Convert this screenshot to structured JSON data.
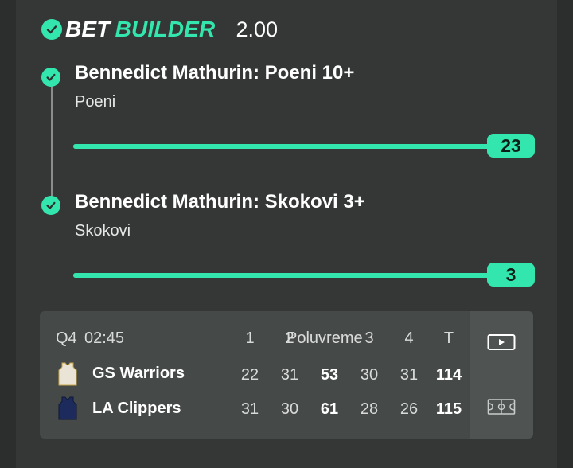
{
  "header": {
    "brand_part1": "BET",
    "brand_part2": "BUILDER",
    "odds": "2.00"
  },
  "legs": [
    {
      "title": "Bennedict Mathurin: Poeni 10+",
      "subtitle": "Poeni",
      "progress_value": "23",
      "progress_fraction": 1.0
    },
    {
      "title": "Bennedict Mathurin: Skokovi 3+",
      "subtitle": "Skokovi",
      "progress_value": "3",
      "progress_fraction": 1.0
    }
  ],
  "scoreboard": {
    "period": "Q4",
    "clock": "02:45",
    "columns": [
      "1",
      "2",
      "Poluvreme",
      "3",
      "4",
      "T"
    ],
    "teams": [
      {
        "name": "GS Warriors",
        "scores": [
          "22",
          "31",
          "53",
          "30",
          "31",
          "114"
        ],
        "jersey_color": "#e9e4d6"
      },
      {
        "name": "LA Clippers",
        "scores": [
          "31",
          "30",
          "61",
          "28",
          "26",
          "115"
        ],
        "jersey_color": "#1d2a5c"
      }
    ],
    "side_icons": [
      "play-video-icon",
      "court-view-icon"
    ]
  },
  "colors": {
    "accent": "#33e6ad",
    "background": "#2b2e2c",
    "card": "#343735"
  }
}
